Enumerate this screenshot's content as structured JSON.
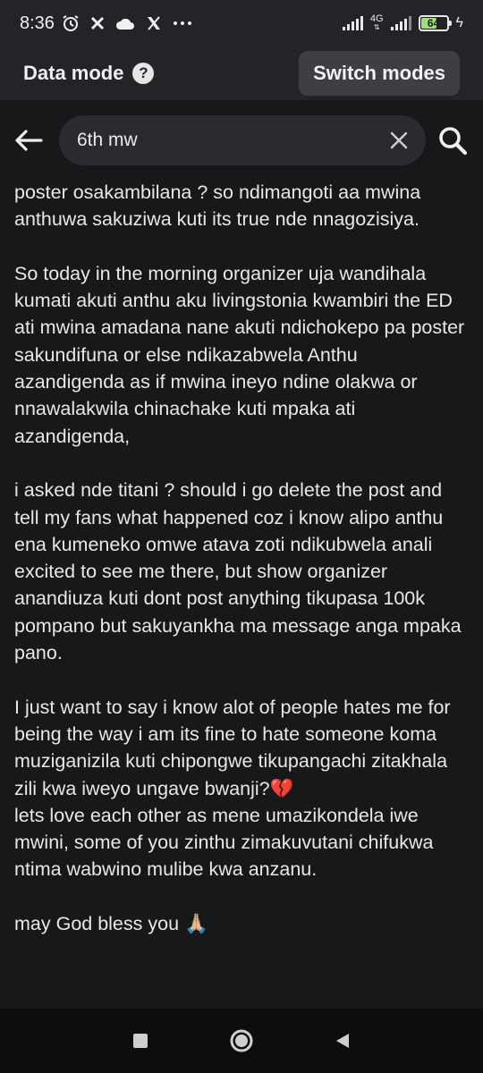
{
  "status_bar": {
    "time": "8:36",
    "left_icons": [
      "alarm-icon",
      "x-mark-icon",
      "cloud-icon",
      "x-logo-icon",
      "more-dots-icon"
    ],
    "network": "4G",
    "battery": "64",
    "battery_level": 0.64
  },
  "data_mode_bar": {
    "title": "Data mode",
    "help_glyph": "?",
    "switch_label": "Switch modes"
  },
  "search": {
    "query": "6th mw"
  },
  "post": {
    "paragraphs": [
      "poster osakambilana ? so ndimangoti aa mwina anthuwa sakuziwa kuti its true nde nnagozisiya.",
      "So today in the morning organizer uja wandihala kumati akuti anthu aku livingstonia kwambiri the ED ati mwina amadana nane akuti ndichokepo pa poster sakundifuna or else ndikazabwela Anthu azandigenda as if mwina ineyo ndine olakwa or nnawalakwila chinachake kuti mpaka ati azandigenda,",
      "i asked nde titani ? should i go delete the post and tell my fans what happened coz i know alipo anthu ena kumeneko omwe atava zoti ndikubwela anali excited to see me there, but show organizer anandiuza kuti dont post anything tikupasa 100k pompano but sakuyankha ma message anga mpaka pano.",
      "I just want to say i know alot of people hates me for being the way i am its fine to hate someone koma muziganizila kuti chipongwe tikupangachi zitakhala zili kwa iweyo ungave bwanji?💔\nlets love each other as mene umazikondela iwe mwini, some of you zinthu zimakuvutani chifukwa ntima wabwino mulibe kwa anzanu.",
      "may God bless you 🙏🏼"
    ]
  },
  "nav": {
    "buttons": [
      "recents-square-icon",
      "home-circle-icon",
      "back-triangle-icon"
    ]
  }
}
